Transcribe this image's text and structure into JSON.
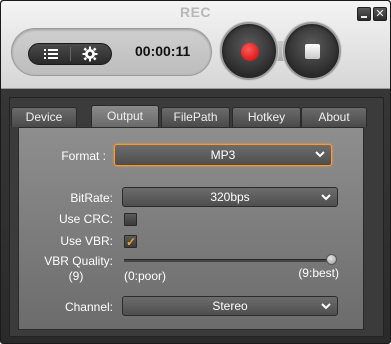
{
  "window": {
    "title": "REC",
    "minimize_label": "",
    "close_label": "✕"
  },
  "recorder": {
    "timer": "00:00:11",
    "list_icon": "list-icon",
    "settings_icon": "gear-icon",
    "record_icon": "record-icon",
    "stop_icon": "stop-icon"
  },
  "tabs": [
    {
      "label": "Device",
      "active": false
    },
    {
      "label": "Output",
      "active": true
    },
    {
      "label": "FilePath",
      "active": false
    },
    {
      "label": "Hotkey",
      "active": false
    },
    {
      "label": "About",
      "active": false
    }
  ],
  "output": {
    "format_label": "Format :",
    "format_value": "MP3",
    "bitrate_label": "BitRate:",
    "bitrate_value": "320bps",
    "use_crc_label": "Use CRC:",
    "use_crc_checked": false,
    "use_vbr_label": "Use VBR:",
    "use_vbr_checked": true,
    "vbr_quality_label": "VBR Quality:",
    "vbr_quality_value": "(9)",
    "vbr_quality_level": 9,
    "vbr_min_label": "(0:poor)",
    "vbr_max_label": "(9:best)",
    "channel_label": "Channel:",
    "channel_value": "Stereo"
  },
  "colors": {
    "accent": "#ff9a2a",
    "record": "#e00000",
    "checkmark": "#f2a020"
  }
}
